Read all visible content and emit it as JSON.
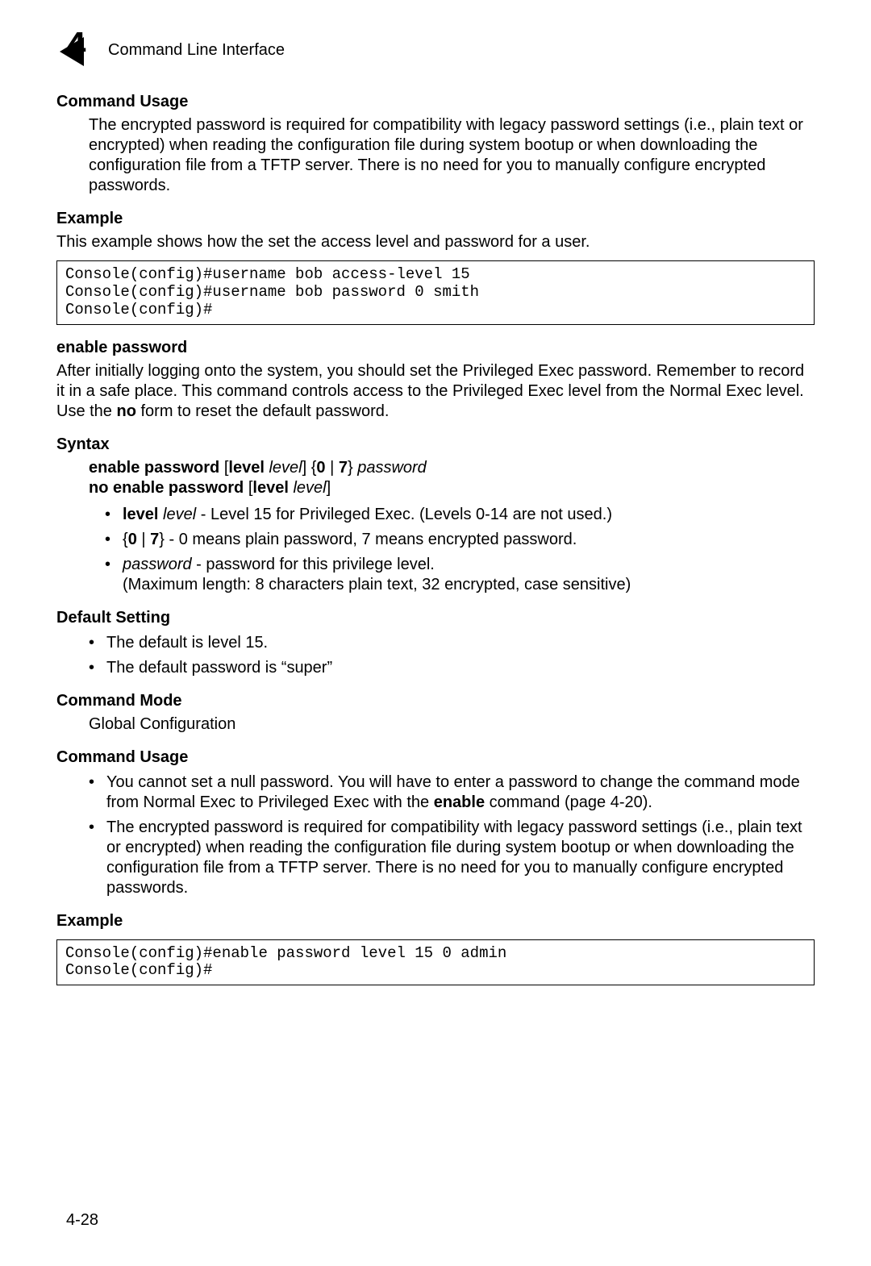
{
  "header": {
    "chapter_number": "4",
    "title": "Command Line Interface"
  },
  "s1": {
    "heading": "Command Usage",
    "para": "The encrypted password is required for compatibility with legacy password settings (i.e., plain text or encrypted) when reading the configuration file during system bootup or when downloading the configuration file from a TFTP server. There is no need for you to manually configure encrypted passwords."
  },
  "s2": {
    "heading": "Example",
    "intro": "This example shows how the set the access level and password for a user.",
    "code": "Console(config)#username bob access-level 15\nConsole(config)#username bob password 0 smith\nConsole(config)#"
  },
  "enable": {
    "heading": "enable password",
    "para_a": "After initially logging onto the system, you should set the Privileged Exec password. Remember to record it in a safe place. This command controls access to the Privileged Exec level from the Normal Exec level. Use the ",
    "para_no": "no",
    "para_b": " form to reset the default password."
  },
  "syntax": {
    "heading": "Syntax",
    "l1": {
      "a": "enable password",
      "b": " [",
      "c": "level",
      "d": " ",
      "e": "level",
      "f": "] {",
      "g": "0",
      "h": " | ",
      "i": "7",
      "j": "} ",
      "k": "password"
    },
    "l2": {
      "a": "no enable password",
      "b": " [",
      "c": "level",
      "d": " ",
      "e": "level",
      "f": "]"
    },
    "b1": {
      "a": "level",
      "b": " ",
      "c": "level",
      "d": " - Level 15 for Privileged Exec. (Levels 0-14 are not used.)"
    },
    "b2": {
      "a": "{",
      "b": "0",
      "c": " | ",
      "d": "7",
      "e": "}",
      "f": " - 0 means plain password, 7 means encrypted password."
    },
    "b3": {
      "a": "password",
      "b": " - password for this privilege level.",
      "c": "(Maximum length: 8 characters plain text, 32 encrypted, case sensitive)"
    }
  },
  "default": {
    "heading": "Default Setting",
    "b1": "The default is level 15.",
    "b2": "The default password is “super”"
  },
  "mode": {
    "heading": "Command Mode",
    "text": "Global Configuration"
  },
  "usage2": {
    "heading": "Command Usage",
    "b1": {
      "a": "You cannot set a null password. You will have to enter a password to change the command mode from Normal Exec to Privileged Exec with the ",
      "b": "enable",
      "c": " command (page 4-20)."
    },
    "b2": "The encrypted password is required for compatibility with legacy password settings (i.e., plain text or encrypted) when reading the configuration file during system bootup or when downloading the configuration file from a TFTP server. There is no need for you to manually configure encrypted passwords."
  },
  "example2": {
    "heading": "Example",
    "code": "Console(config)#enable password level 15 0 admin\nConsole(config)#"
  },
  "page_number": "4-28"
}
